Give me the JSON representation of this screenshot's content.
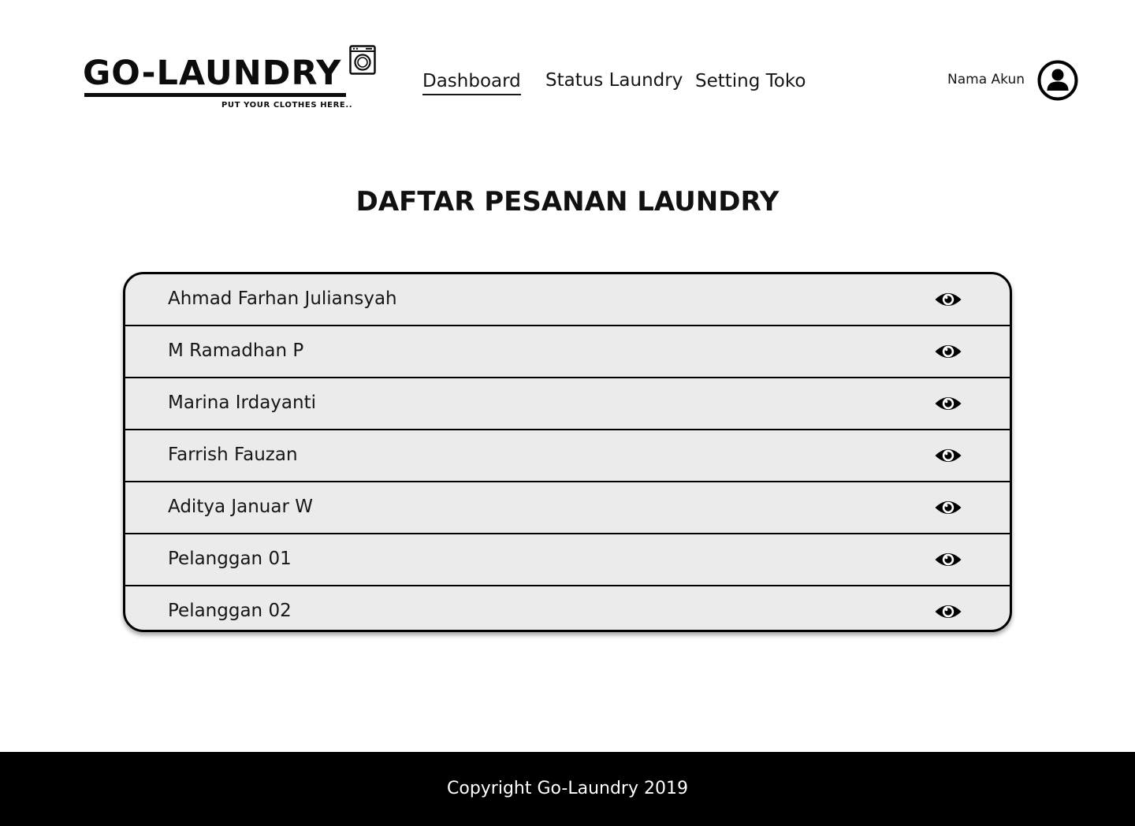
{
  "brand": {
    "name": "GO-LAUNDRY",
    "tagline": "PUT YOUR CLOTHES HERE..",
    "logo_icon": "washing-machine-icon"
  },
  "nav": {
    "items": [
      {
        "label": "Dashboard",
        "active": true
      },
      {
        "label": "Status Laundry",
        "active": false
      },
      {
        "label": "Setting Toko",
        "active": false
      }
    ]
  },
  "account": {
    "name": "Nama Akun",
    "avatar_icon": "user-circle-icon"
  },
  "main": {
    "title": "DAFTAR PESANAN LAUNDRY",
    "orders": [
      {
        "name": "Ahmad Farhan Juliansyah",
        "action_icon": "eye-icon"
      },
      {
        "name": "M Ramadhan P",
        "action_icon": "eye-icon"
      },
      {
        "name": "Marina Irdayanti",
        "action_icon": "eye-icon"
      },
      {
        "name": "Farrish Fauzan",
        "action_icon": "eye-icon"
      },
      {
        "name": "Aditya Januar W",
        "action_icon": "eye-icon"
      },
      {
        "name": "Pelanggan 01",
        "action_icon": "eye-icon"
      },
      {
        "name": "Pelanggan 02",
        "action_icon": "eye-icon"
      }
    ]
  },
  "footer": {
    "text": "Copyright Go-Laundry 2019"
  },
  "colors": {
    "row_background": "#ebebeb",
    "border": "#000000",
    "footer_background": "#000000",
    "footer_text": "#ffffff"
  }
}
